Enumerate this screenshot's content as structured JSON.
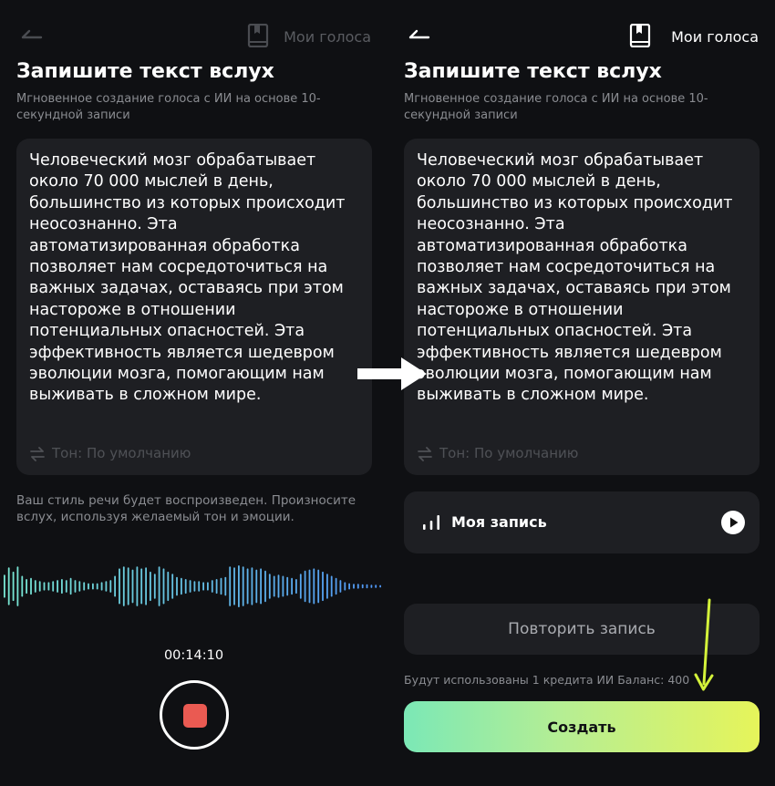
{
  "header": {
    "my_voices_label": "Мои голоса"
  },
  "page": {
    "title": "Запишите текст вслух",
    "subtitle": "Мгновенное создание голоса с ИИ на основе 10-секундной записи"
  },
  "script_text": "Человеческий мозг обрабатывает\nоколо 70 000 мыслей в день,\nбольшинство из которых происходит\nнеосознанно. Эта\nавтоматизированная обработка\nпозволяет нам сосредоточиться на\nважных задачах, оставаясь при этом\nнастороже в отношении\nпотенциальных опасностей. Эта\nэффективность является шедевром\nэволюции мозга, помогающим нам\nвыживать в сложном мире.",
  "tone": {
    "label": "Тон: По умолчанию"
  },
  "recording_screen": {
    "hint": "Ваш стиль речи будет воспроизведен. Произносите вслух, используя желаемый тон и эмоции.",
    "timer": "00:14:10"
  },
  "result_screen": {
    "recording_label": "Моя запись",
    "retry_label": "Повторить запись",
    "credits_text": "Будут использованы 1 кредита ИИ Баланс: 400",
    "create_label": "Создать"
  },
  "colors": {
    "background": "#0f1013",
    "card": "#1e1f23",
    "stop": "#ea5a52",
    "accent_start": "#7be8b6",
    "accent_end": "#e6f45a",
    "annotation_arrow": "#d4f23a"
  }
}
